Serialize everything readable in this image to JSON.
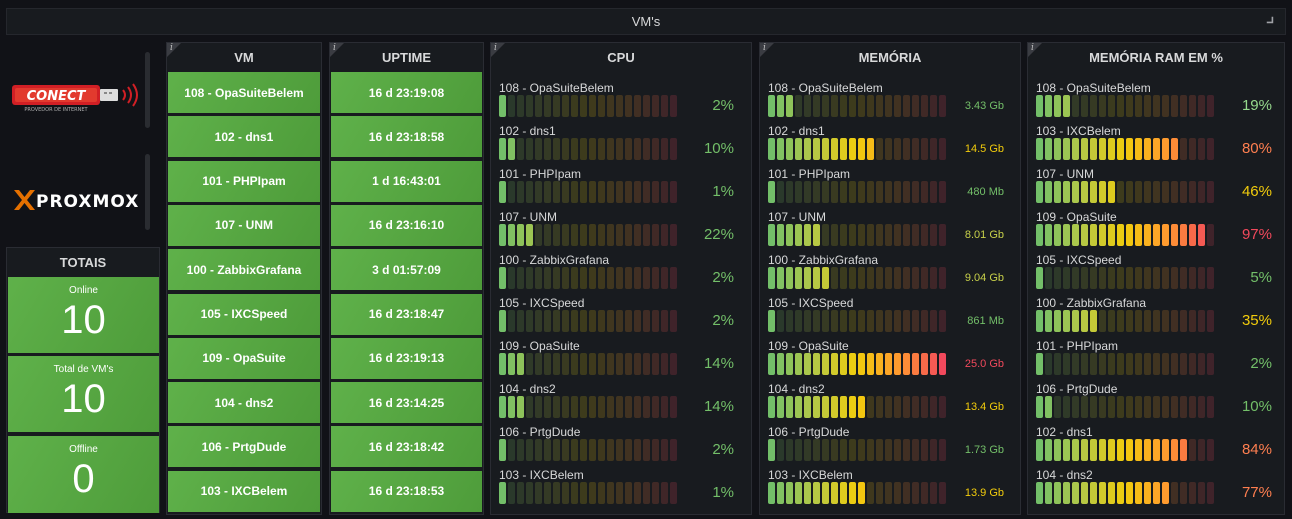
{
  "header": {
    "title": "VM's"
  },
  "logos": {
    "conect_text": "CONECT",
    "conect_sub": "PROVEDOR DE INTERNET",
    "proxmox_text": "PROXMOX"
  },
  "totals": {
    "title": "TOTAIS",
    "online_label": "Online",
    "online_value": "10",
    "total_label": "Total de VM's",
    "total_value": "10",
    "offline_label": "Offline",
    "offline_value": "0"
  },
  "vm_panel": {
    "title": "VM",
    "items": [
      "108 - OpaSuiteBelem",
      "102 - dns1",
      "101 - PHPIpam",
      "107 - UNM",
      "100 - ZabbixGrafana",
      "105 - IXCSpeed",
      "109 - OpaSuite",
      "104 - dns2",
      "106 - PrtgDude",
      "103 - IXCBelem"
    ]
  },
  "uptime_panel": {
    "title": "UPTIME",
    "items": [
      "16 d 23:19:08",
      "16 d 23:18:58",
      "1 d 16:43:01",
      "16 d 23:16:10",
      "3 d 01:57:09",
      "16 d 23:18:47",
      "16 d 23:19:13",
      "16 d 23:14:25",
      "16 d 23:18:42",
      "16 d 23:18:53"
    ]
  },
  "cpu_panel": {
    "title": "CPU",
    "rows": [
      {
        "name": "108 - OpaSuiteBelem",
        "value": "2%",
        "level": 0.02
      },
      {
        "name": "102 - dns1",
        "value": "10%",
        "level": 0.1
      },
      {
        "name": "101 - PHPIpam",
        "value": "1%",
        "level": 0.01
      },
      {
        "name": "107 - UNM",
        "value": "22%",
        "level": 0.22
      },
      {
        "name": "100 - ZabbixGrafana",
        "value": "2%",
        "level": 0.02
      },
      {
        "name": "105 - IXCSpeed",
        "value": "2%",
        "level": 0.02
      },
      {
        "name": "109 - OpaSuite",
        "value": "14%",
        "level": 0.14
      },
      {
        "name": "104 - dns2",
        "value": "14%",
        "level": 0.14
      },
      {
        "name": "106 - PrtgDude",
        "value": "2%",
        "level": 0.02
      },
      {
        "name": "103 - IXCBelem",
        "value": "1%",
        "level": 0.01
      }
    ]
  },
  "mem_panel": {
    "title": "MEMÓRIA",
    "rows": [
      {
        "name": "108 - OpaSuiteBelem",
        "value": "3.43 Gb",
        "level": 0.14,
        "color": "#73bf69"
      },
      {
        "name": "102 - dns1",
        "value": "14.5 Gb",
        "level": 0.58,
        "color": "#f2cc0c"
      },
      {
        "name": "101 - PHPIpam",
        "value": "480 Mb",
        "level": 0.02,
        "color": "#73bf69"
      },
      {
        "name": "107 - UNM",
        "value": "8.01 Gb",
        "level": 0.32,
        "color": "#c8d14a"
      },
      {
        "name": "100 - ZabbixGrafana",
        "value": "9.04 Gb",
        "level": 0.36,
        "color": "#c8d14a"
      },
      {
        "name": "105 - IXCSpeed",
        "value": "861 Mb",
        "level": 0.03,
        "color": "#73bf69"
      },
      {
        "name": "109 - OpaSuite",
        "value": "25.0 Gb",
        "level": 1.0,
        "color": "#f2495c"
      },
      {
        "name": "104 - dns2",
        "value": "13.4 Gb",
        "level": 0.54,
        "color": "#f2cc0c"
      },
      {
        "name": "106 - PrtgDude",
        "value": "1.73 Gb",
        "level": 0.07,
        "color": "#73bf69"
      },
      {
        "name": "103 - IXCBelem",
        "value": "13.9 Gb",
        "level": 0.56,
        "color": "#f2cc0c"
      }
    ]
  },
  "ram_panel": {
    "title": "MEMÓRIA RAM EM %",
    "rows": [
      {
        "name": "108 - OpaSuiteBelem",
        "value": "19%",
        "level": 0.19,
        "color": "#96d98d"
      },
      {
        "name": "103 - IXCBelem",
        "value": "80%",
        "level": 0.8,
        "color": "#ff7f50"
      },
      {
        "name": "107 - UNM",
        "value": "46%",
        "level": 0.46,
        "color": "#f2cc0c"
      },
      {
        "name": "109 - OpaSuite",
        "value": "97%",
        "level": 0.97,
        "color": "#f2495c"
      },
      {
        "name": "105 - IXCSpeed",
        "value": "5%",
        "level": 0.05,
        "color": "#73bf69"
      },
      {
        "name": "100 - ZabbixGrafana",
        "value": "35%",
        "level": 0.35,
        "color": "#f2cc0c"
      },
      {
        "name": "101 - PHPIpam",
        "value": "2%",
        "level": 0.02,
        "color": "#73bf69"
      },
      {
        "name": "106 - PrtgDude",
        "value": "10%",
        "level": 0.1,
        "color": "#73bf69"
      },
      {
        "name": "102 - dns1",
        "value": "84%",
        "level": 0.84,
        "color": "#ff7f50"
      },
      {
        "name": "104 - dns2",
        "value": "77%",
        "level": 0.77,
        "color": "#ff7f50"
      }
    ]
  },
  "colors": {
    "green": "#73bf69",
    "yellow": "#f2cc0c",
    "orange": "#ff7f50",
    "red": "#f2495c",
    "cell": "#56a440",
    "panel_bg": "#181b1f",
    "page_bg": "#111217"
  }
}
